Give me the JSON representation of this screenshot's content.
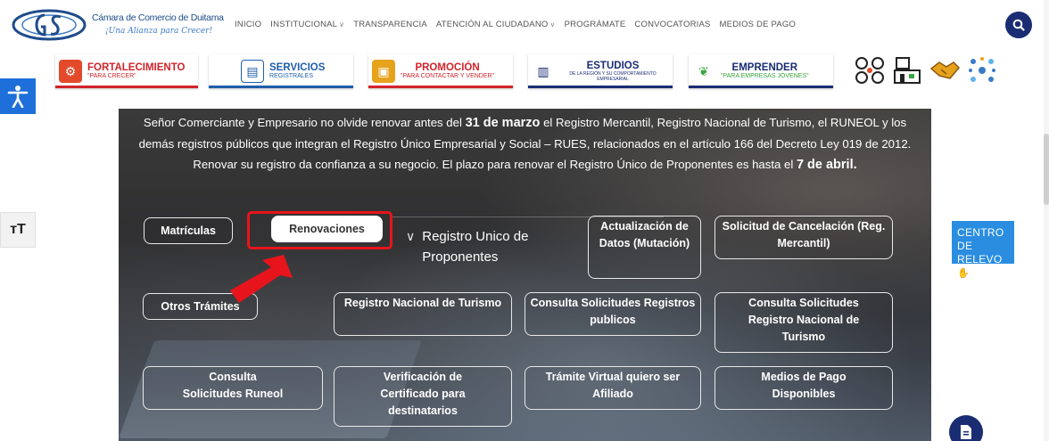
{
  "header": {
    "logo_line1": "Cámara de Comercio de Duitama",
    "logo_line2": "¡Una Alianza para Crecer!",
    "nav": [
      {
        "label": "INICIO",
        "dropdown": false
      },
      {
        "label": "INSTITUCIONAL",
        "dropdown": true
      },
      {
        "label": "TRANSPARENCIA",
        "dropdown": false
      },
      {
        "label": "ATENCIÓN AL CIUDADANO",
        "dropdown": true
      },
      {
        "label": "PROGRÁMATE",
        "dropdown": false
      },
      {
        "label": "CONVOCATORIAS",
        "dropdown": false
      },
      {
        "label": "MEDIOS DE PAGO",
        "dropdown": false
      }
    ]
  },
  "banners": [
    {
      "title": "FORTALECIMIENTO",
      "subtitle": "\"PARA CRECER\"",
      "color": "#d2232a",
      "icon_color": "#e24a2b"
    },
    {
      "title": "SERVICIOS",
      "subtitle": "REGISTRALES",
      "color": "#1f5eaa",
      "icon_color": "#1f5eaa"
    },
    {
      "title": "PROMOCIÓN",
      "subtitle": "\"PARA CONTACTAR Y VENDER\"",
      "color": "#d2232a",
      "icon_color": "#e7a21c"
    },
    {
      "title": "ESTUDIOS",
      "subtitle": "DE LA REGIÓN Y SU COMPORTAMIENTO EMPRESARIAL",
      "color": "#1a2d73",
      "icon_color": "#1a2d73"
    },
    {
      "title": "EMPRENDER",
      "subtitle": "\"PARA EMPRESAS JÓVENES\"",
      "color": "#1a2d73",
      "icon_color": "#3aa53f"
    }
  ],
  "hero": {
    "text_1": "Señor Comerciante y Empresario no olvide renovar antes del ",
    "bold_1": "31 de marzo",
    "text_2": " el Registro Mercantil, Registro Nacional de Turismo, el RUNEOL y los demás registros públicos que integran el Registro Único Empresarial y Social – RUES, relacionados en el artículo 166 del Decreto Ley 019 de 2012.  Renovar su registro da confianza a su negocio.  El plazo para renovar el Registro Único de Proponentes es hasta el ",
    "bold_2": "7 de abril."
  },
  "buttons": {
    "matriculas": "Matrículas",
    "renovaciones": "Renovaciones",
    "rup": "Registro Unico de Proponentes",
    "actualizacion": "Actualización de Datos (Mutación)",
    "cancelacion": "Solicitud de Cancelación (Reg. Mercantil)",
    "otros": "Otros Trámites",
    "rnt": "Registro Nacional de Turismo",
    "consulta_publicos": "Consulta Solicitudes Registros publicos",
    "consulta_rnt": "Consulta Solicitudes Registro Nacional de Turismo",
    "consulta_runeol": "Consulta Solicitudes Runeol",
    "verificacion": "Verificación de Certificado para destinatarios",
    "afiliado": "Trámite Virtual quiero ser Afiliado",
    "medios": "Medios de Pago Disponibles"
  },
  "side": {
    "text_size": "тT",
    "relevo": "CENTRO DE RELEVO"
  }
}
